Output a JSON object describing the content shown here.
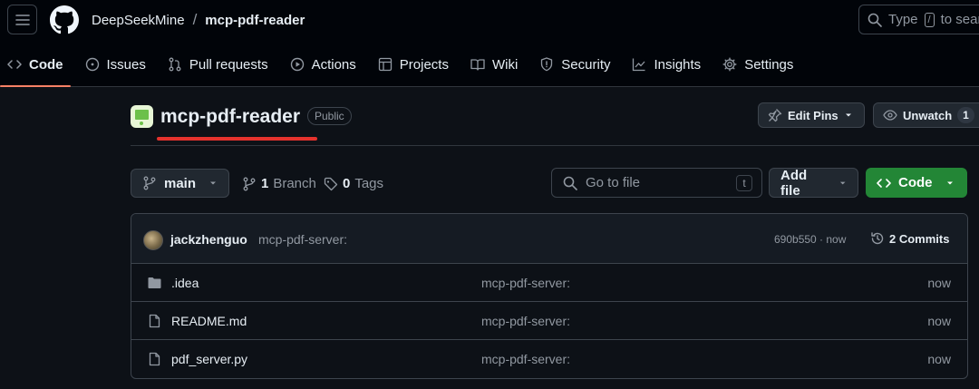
{
  "header": {
    "owner": "DeepSeekMine",
    "separator": "/",
    "repo": "mcp-pdf-reader",
    "search_placeholder_prefix": "Type",
    "search_key": "/",
    "search_placeholder_suffix": "to sear"
  },
  "tabs": [
    {
      "label": "Code",
      "icon": "code-icon",
      "active": true
    },
    {
      "label": "Issues",
      "icon": "issue-icon"
    },
    {
      "label": "Pull requests",
      "icon": "pull-request-icon"
    },
    {
      "label": "Actions",
      "icon": "play-icon"
    },
    {
      "label": "Projects",
      "icon": "table-icon"
    },
    {
      "label": "Wiki",
      "icon": "book-icon"
    },
    {
      "label": "Security",
      "icon": "shield-icon"
    },
    {
      "label": "Insights",
      "icon": "graph-icon"
    },
    {
      "label": "Settings",
      "icon": "gear-icon"
    }
  ],
  "repo": {
    "name": "mcp-pdf-reader",
    "visibility": "Public",
    "edit_pins_label": "Edit Pins",
    "unwatch_label": "Unwatch",
    "watch_count": "1"
  },
  "toolbar": {
    "branch": "main",
    "branch_count": "1",
    "branch_label": "Branch",
    "tag_count": "0",
    "tag_label": "Tags",
    "goto_placeholder": "Go to file",
    "goto_key": "t",
    "add_file_label": "Add file",
    "code_label": "Code"
  },
  "latest_commit": {
    "user": "jackzhenguo",
    "message": "mcp-pdf-server:",
    "hash_time": "690b550 · now",
    "commits_label": "2 Commits"
  },
  "files": [
    {
      "name": ".idea",
      "type": "folder",
      "message": "mcp-pdf-server:",
      "time": "now"
    },
    {
      "name": "README.md",
      "type": "file",
      "message": "mcp-pdf-server:",
      "time": "now"
    },
    {
      "name": "pdf_server.py",
      "type": "file",
      "message": "mcp-pdf-server:",
      "time": "now"
    }
  ],
  "colors": {
    "background": "#0d1117",
    "accent_tab_underline": "#f78166",
    "code_button": "#238636",
    "annotation_red": "#e5322d"
  }
}
